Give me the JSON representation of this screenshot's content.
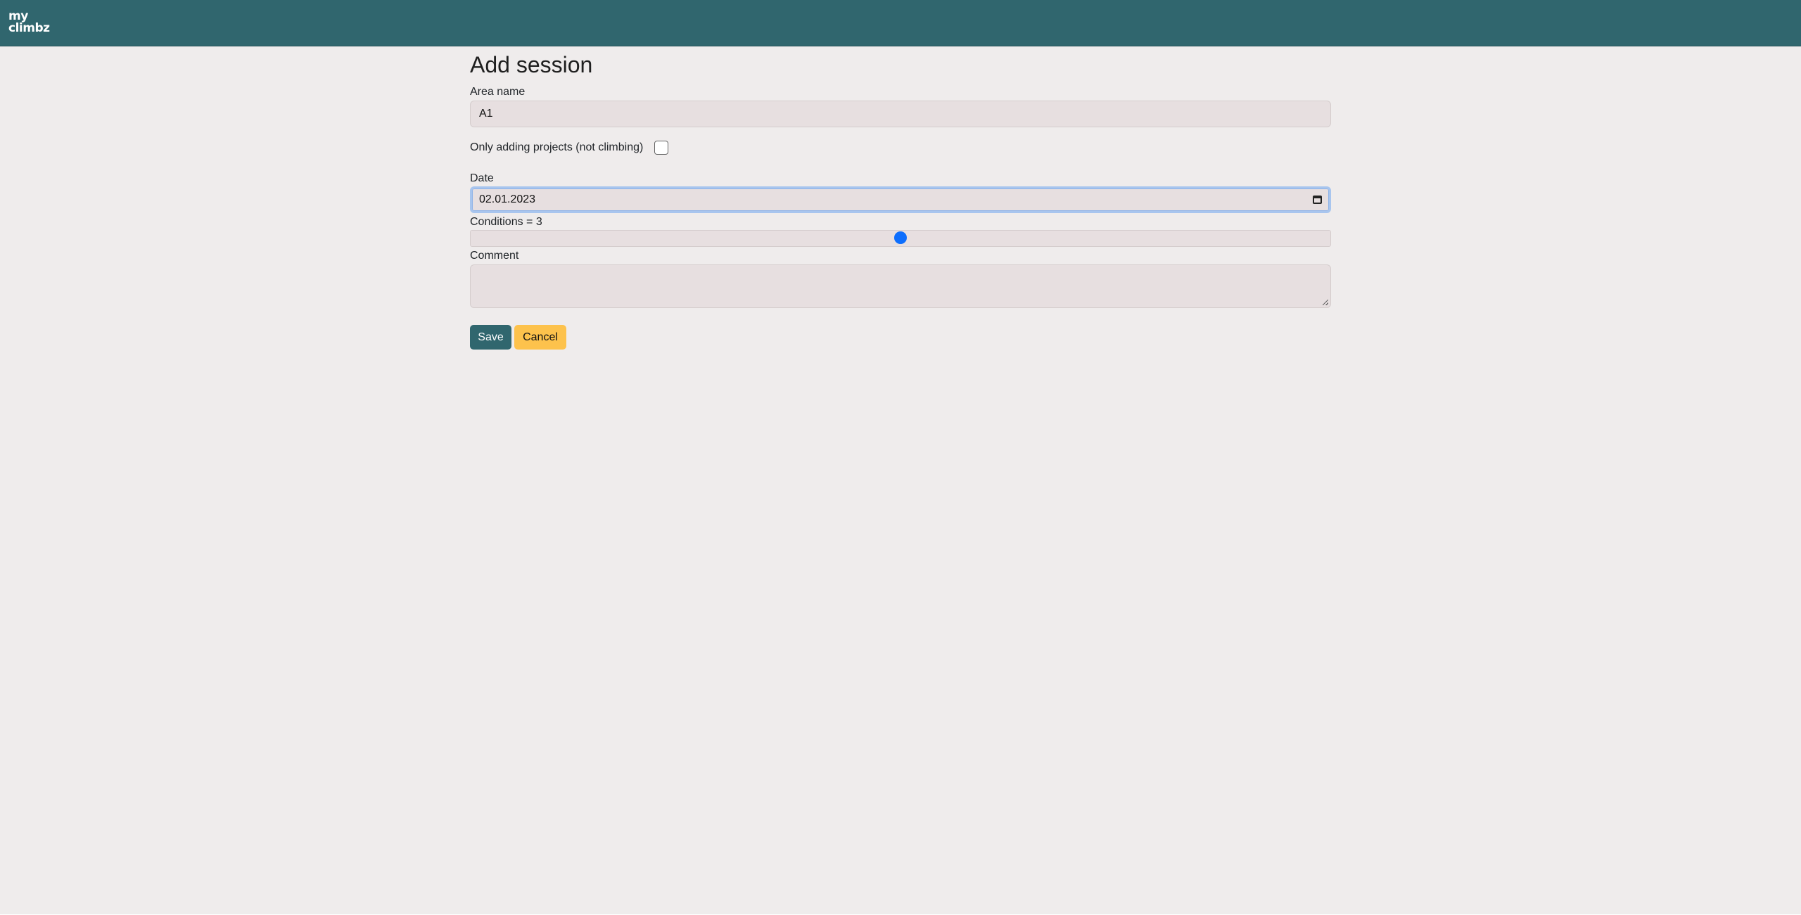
{
  "navbar": {
    "logo_line1": "my",
    "logo_line2": "climbz"
  },
  "page": {
    "title": "Add session"
  },
  "form": {
    "area_name": {
      "label": "Area name",
      "value": "A1"
    },
    "projects_only": {
      "label": "Only adding projects (not climbing)",
      "checked": false
    },
    "date": {
      "label": "Date",
      "value": "02.01.2023"
    },
    "conditions": {
      "label": "Conditions = 3",
      "value": 3,
      "min": 1,
      "max": 5
    },
    "comment": {
      "label": "Comment",
      "value": ""
    },
    "save_label": "Save",
    "cancel_label": "Cancel"
  },
  "colors": {
    "navbar": "#30666e",
    "save_button": "#30666e",
    "cancel_button": "#fdc24c",
    "slider_thumb": "#0d6efd"
  },
  "icons": {
    "date_picker": "calendar-icon"
  }
}
